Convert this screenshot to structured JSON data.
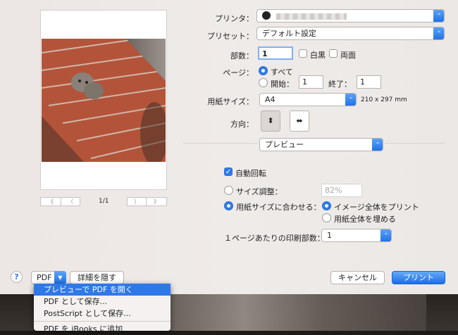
{
  "printer": {
    "label": "プリンタ：",
    "value": ""
  },
  "preset": {
    "label": "プリセット：",
    "value": "デフォルト設定"
  },
  "copies": {
    "label": "部数：",
    "value": "1",
    "bw_label": "白黒",
    "duplex_label": "両面"
  },
  "pages": {
    "label": "ページ：",
    "all_label": "すべて",
    "from_label": "開始：",
    "from_value": "1",
    "to_label": "終了：",
    "to_value": "1"
  },
  "paper": {
    "label": "用紙サイズ：",
    "value": "A4",
    "dimensions": "210 x 297 mm"
  },
  "orientation": {
    "label": "方向："
  },
  "section_popup": {
    "value": "プレビュー"
  },
  "preview_options": {
    "auto_rotate_label": "自動回転",
    "scale_label": "サイズ調整：",
    "scale_placeholder": "82%",
    "fit_label": "用紙サイズに合わせる：",
    "print_entire_label": "イメージ全体をプリント",
    "fill_paper_label": "用紙全体を埋める",
    "per_page_label": "１ページあたりの印刷部数：",
    "per_page_value": "1"
  },
  "preview_nav": {
    "page_indicator": "1/1",
    "first": "《",
    "prev": "〈",
    "next": "〉",
    "last": "》"
  },
  "footer": {
    "help": "?",
    "pdf_button": "PDF",
    "hide_details": "詳細を隠す",
    "cancel": "キャンセル",
    "print": "プリント"
  },
  "pdf_menu": {
    "items": [
      "プレビューで PDF を開く",
      "PDF として保存...",
      "PostScript として保存...",
      "PDF を iBooks に追加"
    ]
  },
  "colors": {
    "accent": "#2f78e8",
    "dialog_bg": "#ece7e5"
  }
}
